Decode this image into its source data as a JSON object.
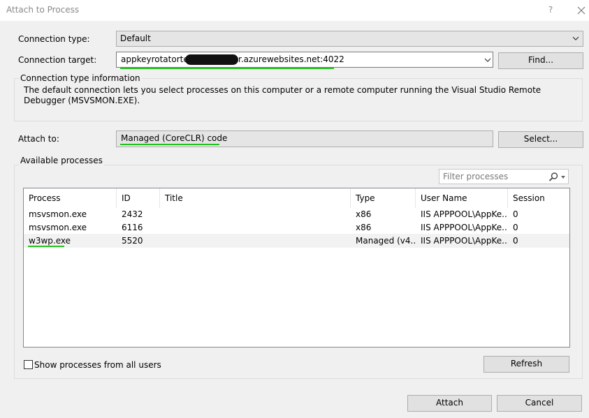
{
  "window": {
    "title": "Attach to Process",
    "help_label": "?"
  },
  "connection_type": {
    "label": "Connection type:",
    "value": "Default"
  },
  "connection_target": {
    "label": "Connection target:",
    "value_prefix": "appkeyrotatortest",
    "value_suffix": "r.azurewebsites.net:4022",
    "find_label": "Find..."
  },
  "info": {
    "label": "Connection type information",
    "text": "The default connection lets you select processes on this computer or a remote computer running the Visual Studio Remote Debugger (MSVSMON.EXE)."
  },
  "attach_to": {
    "label": "Attach to:",
    "value": "Managed (CoreCLR) code",
    "select_label": "Select..."
  },
  "available": {
    "label": "Available processes",
    "filter_placeholder": "Filter processes",
    "columns": [
      "Process",
      "ID",
      "Title",
      "Type",
      "User Name",
      "Session"
    ],
    "rows": [
      {
        "process": "msvsmon.exe",
        "id": "2432",
        "title": "",
        "type": "x86",
        "user": "IIS APPPOOL\\AppKe...",
        "session": "0"
      },
      {
        "process": "msvsmon.exe",
        "id": "6116",
        "title": "",
        "type": "x86",
        "user": "IIS APPPOOL\\AppKe...",
        "session": "0"
      },
      {
        "process": "w3wp.exe",
        "id": "5520",
        "title": "",
        "type": "Managed (v4....",
        "user": "IIS APPPOOL\\AppKe...",
        "session": "0"
      }
    ]
  },
  "show_all": {
    "label": "Show processes from all users",
    "checked": false
  },
  "buttons": {
    "refresh": "Refresh",
    "attach": "Attach",
    "cancel": "Cancel"
  },
  "colors": {
    "annotation": "#22c21f",
    "redaction": "#111111",
    "background": "#f0f0f0"
  }
}
